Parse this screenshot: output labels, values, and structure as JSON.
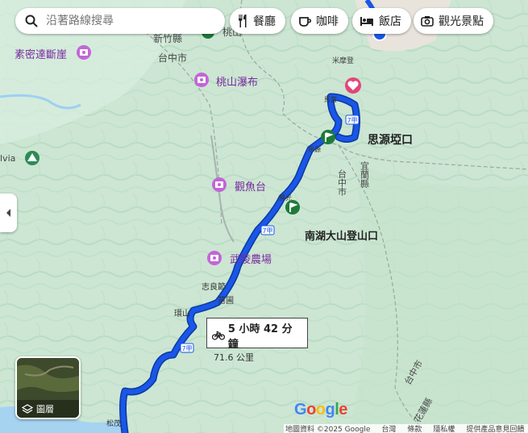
{
  "search": {
    "placeholder": "沿著路線搜尋"
  },
  "chips": [
    {
      "label": "餐廳",
      "icon": "fork-knife-icon"
    },
    {
      "label": "咖啡",
      "icon": "coffee-cup-icon"
    },
    {
      "label": "飯店",
      "icon": "bed-icon"
    },
    {
      "label": "觀光景點",
      "icon": "camera-icon"
    }
  ],
  "places": {
    "sumida_cliff": "素密達斷崖",
    "taichung_nw": "台中市",
    "hsinchu": "新竹縣",
    "taoshan_pass": "桃山",
    "taoshan_falls": "桃山瀑布",
    "mimoden": "米摩登",
    "sz_yuan_pass": "思源埡口",
    "yilan": "宜蘭縣",
    "taichung_mid": "台中市",
    "fish_platform": "觀魚台",
    "nanhu_trailhead": "南湖大山登山口",
    "wuling_farm": "武陵農場",
    "zhiliang": "志良節",
    "pine_garden": "苗圃",
    "huanshan": "環山",
    "taichung_se": "台中市",
    "hualien": "花蓮縣",
    "songmao": "松茂",
    "elvia": "lvia",
    "matang": "馬當",
    "sijie": "思源",
    "jiaxing": "勝光"
  },
  "road_labels": [
    "7甲",
    "7甲",
    "7甲",
    "7甲"
  ],
  "route": {
    "time": "5 小時 42 分鐘",
    "distance": "71.6 公里",
    "mode": "bicycle-icon",
    "color": "#1a56e8"
  },
  "layers": {
    "label": "圖層"
  },
  "footer": {
    "copyright": "地圖資料 ©2025 Google",
    "region": "台灣",
    "terms": "條款",
    "privacy": "隱私權",
    "feedback": "提供產品意見回饋"
  },
  "branding": {
    "logo": "Google"
  },
  "colors": {
    "map_green": "#cfe8d8",
    "poi_purple": "#c266d6",
    "poi_green": "#2e8b57",
    "route_blue": "#1a56e8",
    "heart_pink": "#e2467a"
  }
}
